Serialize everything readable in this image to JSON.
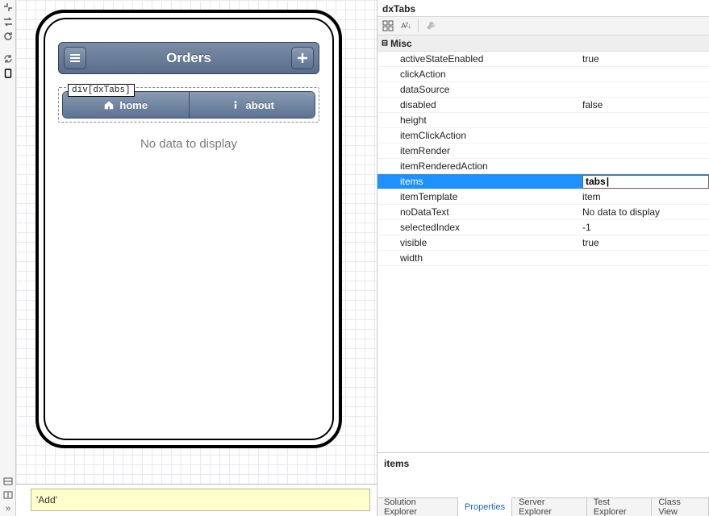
{
  "designer": {
    "header_title": "Orders",
    "selection_tag": "div[dxTabs]",
    "tabs": [
      {
        "icon": "home",
        "label": "home"
      },
      {
        "icon": "info",
        "label": "about"
      }
    ],
    "no_data_text": "No data to display",
    "status_input": "'Add'"
  },
  "prop": {
    "component": "dxTabs",
    "category": "Misc",
    "selected_key": "items",
    "selected_value": "tabs",
    "rows": [
      {
        "k": "activeStateEnabled",
        "v": "true"
      },
      {
        "k": "clickAction",
        "v": ""
      },
      {
        "k": "dataSource",
        "v": ""
      },
      {
        "k": "disabled",
        "v": "false"
      },
      {
        "k": "height",
        "v": ""
      },
      {
        "k": "itemClickAction",
        "v": ""
      },
      {
        "k": "itemRender",
        "v": ""
      },
      {
        "k": "itemRenderedAction",
        "v": ""
      },
      {
        "k": "items",
        "v": "tabs",
        "selected": true
      },
      {
        "k": "itemTemplate",
        "v": "item"
      },
      {
        "k": "noDataText",
        "v": "No data to display"
      },
      {
        "k": "selectedIndex",
        "v": "-1"
      },
      {
        "k": "visible",
        "v": "true"
      },
      {
        "k": "width",
        "v": ""
      }
    ],
    "desc_key": "items"
  },
  "bottom_tabs": [
    "Solution Explorer",
    "Properties",
    "Server Explorer",
    "Test Explorer",
    "Class View"
  ],
  "bottom_active": "Properties"
}
